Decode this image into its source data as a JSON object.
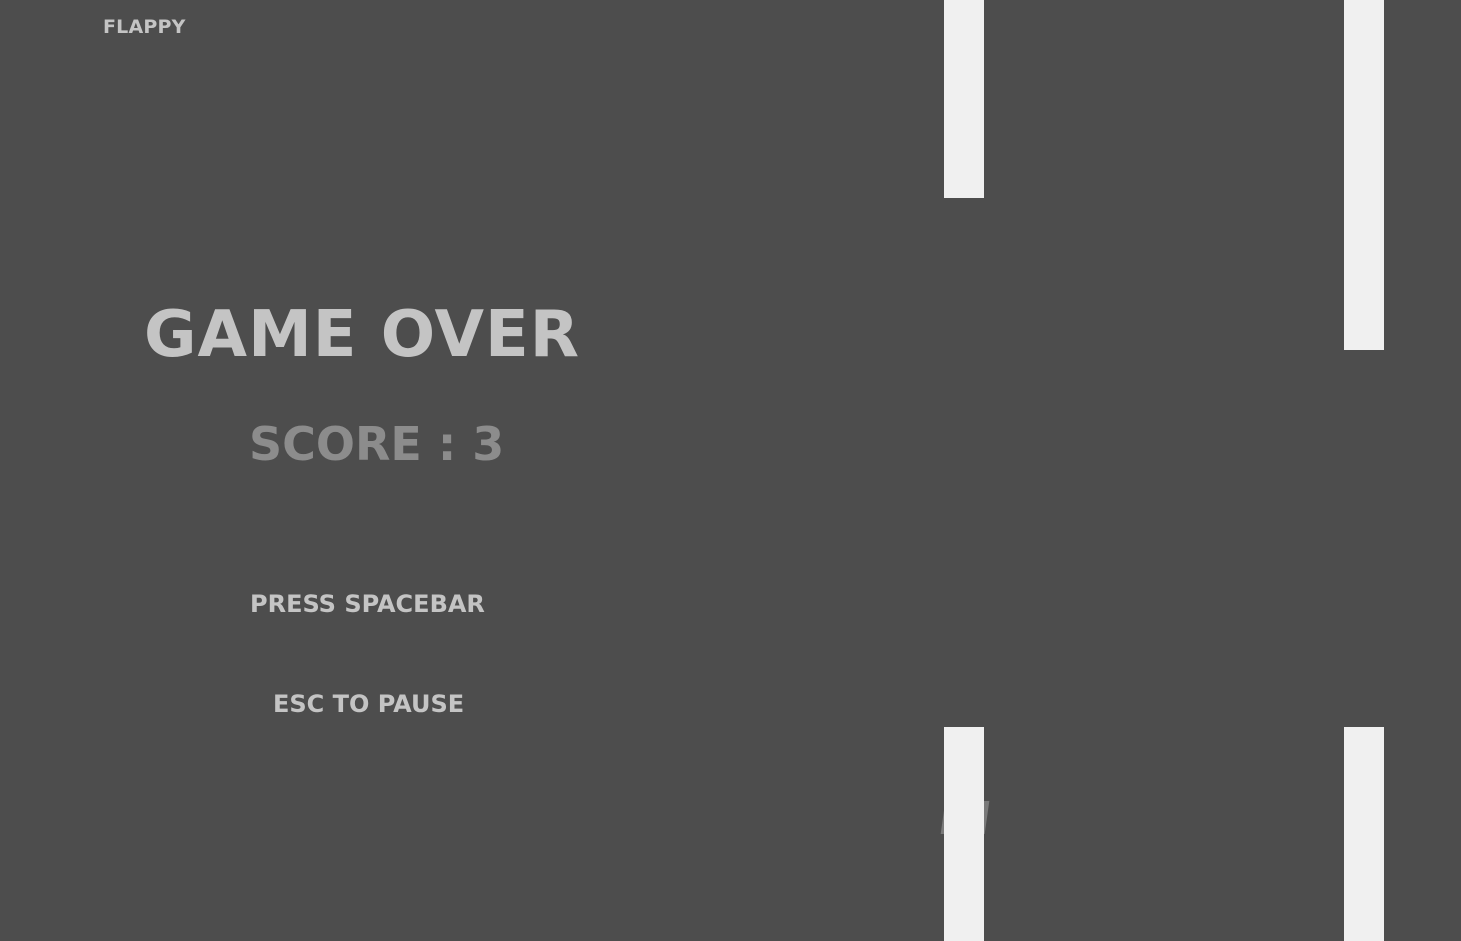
{
  "game": {
    "title": "FLAPPY",
    "game_over_label": "GAME OVER",
    "score_label": "SCORE : 3",
    "score": 3,
    "press_hint": "PRESS SPACEBAR",
    "pause_hint": "ESC TO PAUSE"
  },
  "colors": {
    "background": "#4d4d4d",
    "pipe": "#f0f0f0",
    "text": "#c4c4c4",
    "score_text": "#8c8c8c"
  }
}
